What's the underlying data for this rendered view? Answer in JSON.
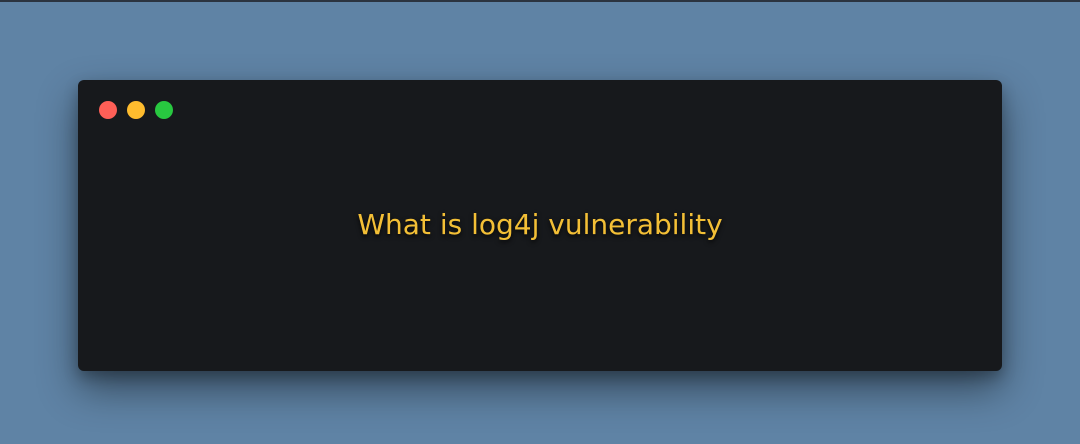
{
  "window": {
    "controls": [
      {
        "name": "close",
        "color": "#ff5f57",
        "icon": "traffic-light-red-icon"
      },
      {
        "name": "minimize",
        "color": "#febc2e",
        "icon": "traffic-light-yellow-icon"
      },
      {
        "name": "zoom",
        "color": "#28c840",
        "icon": "traffic-light-green-icon"
      }
    ],
    "background_color": "#17191c"
  },
  "content": {
    "headline": "What is log4j vulnerability",
    "headline_color": "#f3bf36"
  },
  "page": {
    "background_color": "#5f83a5"
  }
}
